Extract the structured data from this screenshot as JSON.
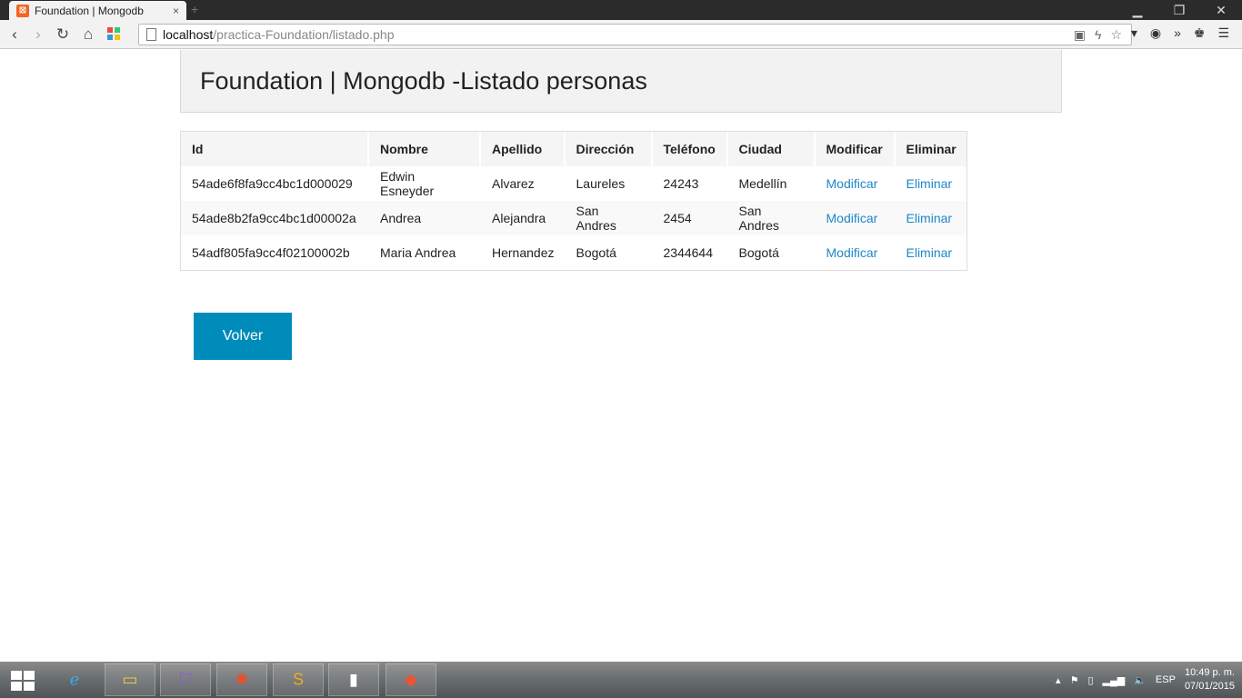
{
  "browser": {
    "tab_title": "Foundation | Mongodb",
    "tab_close": "×",
    "new_tab": "+",
    "url_host": "localhost",
    "url_path": "/practica-Foundation/listado.php"
  },
  "page": {
    "heading": "Foundation | Mongodb -Listado personas",
    "table": {
      "headers": [
        "Id",
        "Nombre",
        "Apellido",
        "Dirección",
        "Teléfono",
        "Ciudad",
        "Modificar",
        "Eliminar"
      ],
      "rows": [
        {
          "id": "54ade6f8fa9cc4bc1d000029",
          "nombre": "Edwin Esneyder",
          "apellido": "Alvarez",
          "direccion": "Laureles",
          "telefono": "24243",
          "ciudad": "Medellín",
          "modificar": "Modificar",
          "eliminar": "Eliminar"
        },
        {
          "id": "54ade8b2fa9cc4bc1d00002a",
          "nombre": "Andrea",
          "apellido": "Alejandra",
          "direccion": "San Andres",
          "telefono": "2454",
          "ciudad": "San Andres",
          "modificar": "Modificar",
          "eliminar": "Eliminar"
        },
        {
          "id": "54adf805fa9cc4f02100002b",
          "nombre": "Maria Andrea",
          "apellido": "Hernandez",
          "direccion": "Bogotá",
          "telefono": "2344644",
          "ciudad": "Bogotá",
          "modificar": "Modificar",
          "eliminar": "Eliminar"
        }
      ]
    },
    "back_button": "Volver"
  },
  "taskbar": {
    "language": "ESP",
    "time": "10:49 p. m.",
    "date": "07/01/2015"
  },
  "colors": {
    "link": "#1e87c9",
    "button": "#008cba"
  }
}
